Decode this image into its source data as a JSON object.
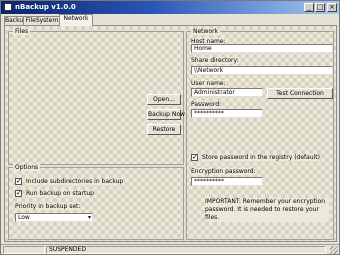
{
  "window": {
    "title": "nBackup v1.0.0"
  },
  "tabs": [
    "Backup",
    "FileSystem",
    "Network"
  ],
  "left_group": {
    "legend": "Files",
    "buttons": {
      "open": "Open...",
      "backup_now": "Backup Now",
      "restore": "Restore"
    }
  },
  "options_group": {
    "legend": "Options",
    "check1": "Include subdirectories in backup",
    "check2": "Run backup on startup",
    "priority_label": "Priority in backup set:",
    "priority_value": "Low"
  },
  "right_group": {
    "legend": "Network",
    "host_label": "Host name:",
    "host_value": "Home",
    "share_label": "Share directory:",
    "share_value": "\\\\Network",
    "user_label": "User name:",
    "user_value": "Administrator",
    "password_label": "Password:",
    "password_value": "**********",
    "test_button": "Test Connection",
    "store_label": "Store password in the registry (default)",
    "encrypt_label": "Encryption password:",
    "encrypt_value": "**********",
    "important_note": "IMPORTANT: Remember your encryption password. It is needed to restore your files."
  },
  "status": {
    "text": "SUSPENDED"
  },
  "colors": {
    "title_start": "#0a246a",
    "title_end": "#a6caf0",
    "face": "#e6e3d6"
  }
}
